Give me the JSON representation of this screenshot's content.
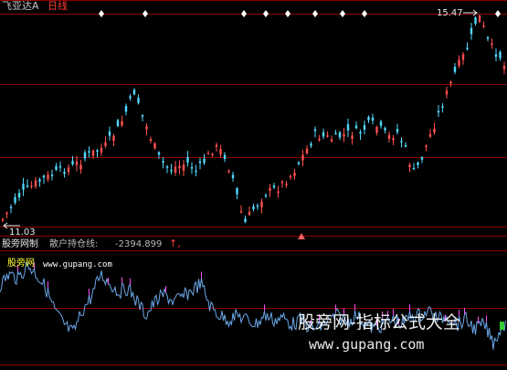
{
  "header": {
    "stock_name": "飞亚达A",
    "period": "日线"
  },
  "price_panel": {
    "high_label": "15.47",
    "low_label": "11.03",
    "signal_icon": "diamond-signal-icon",
    "signals": [
      {
        "bar": 8
      },
      {
        "bar": 16
      },
      {
        "bar": 34
      },
      {
        "bar": 38
      },
      {
        "bar": 42
      },
      {
        "bar": 47
      },
      {
        "bar": 52
      },
      {
        "bar": 56
      },
      {
        "bar": 83
      }
    ],
    "triangle_icon": "buy-triangle-icon"
  },
  "indicator_panel": {
    "title": "股旁网制",
    "name": "散户持仓线:",
    "value": "-2394.899",
    "mark": "↑,"
  },
  "site_logo": "股旁网",
  "site_url": "www.gupang.com",
  "watermark": {
    "title": "股旁网-指标公式大全",
    "url": "www.gupang.com"
  },
  "colors": {
    "background": "#000000",
    "up_candle": "#ff5050",
    "down_candle": "#54d8ff",
    "grid_line": "#8a0000",
    "indicator_line": "#6aa8e8",
    "indicator_marker": "#ff50ff"
  }
}
